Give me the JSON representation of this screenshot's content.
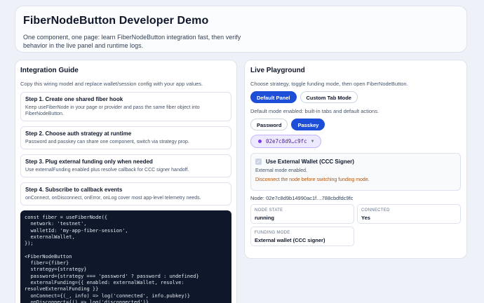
{
  "header": {
    "title": "FiberNodeButton Developer Demo",
    "description": "One component, one page: learn FiberNodeButton integration fast, then verify behavior in the live panel and runtime logs."
  },
  "guide": {
    "title": "Integration Guide",
    "subtitle": "Copy this wiring model and replace wallet/session config with your app values.",
    "steps": [
      {
        "title": "Step 1. Create one shared fiber hook",
        "desc": "Keep useFiberNode in your page or provider and pass the same fiber object into FiberNodeButton."
      },
      {
        "title": "Step 2. Choose auth strategy at runtime",
        "desc": "Password and passkey can share one component, switch via strategy prop."
      },
      {
        "title": "Step 3. Plug external funding only when needed",
        "desc": "Use externalFunding enabled plus resolve callback for CCC signer handoff."
      },
      {
        "title": "Step 4. Subscribe to callback events",
        "desc": "onConnect, onDisconnect, onError, onLog cover most app-level telemetry needs."
      }
    ],
    "code": "const fiber = useFiberNode({\n  network: 'testnet',\n  walletId: 'my-app-fiber-session',\n  externalWallet,\n});\n\n<FiberNodeButton\n  fiber={fiber}\n  strategy={strategy}\n  password={strategy === 'password' ? password : undefined}\n  externalFunding={{ enabled: externalWallet, resolve:\nresolveExternalFunding }}\n  onConnect={(_, info) => log('connected', info.pubkey)}\n  onDisconnect={() => log('disconnected')}"
  },
  "playground": {
    "title": "Live Playground",
    "subtitle": "Choose strategy, toggle funding mode, then open FiberNodeButton.",
    "mode_buttons": {
      "default": "Default Panel",
      "custom": "Custom Tab Mode"
    },
    "mode_hint": "Default mode enabled: built-in tabs and default actions.",
    "auth_buttons": {
      "password": "Password",
      "passkey": "Passkey"
    },
    "node_button": {
      "label": "02e7c8d9…c9fc"
    },
    "external": {
      "checkbox_label": "Use External Wallet (CCC Signer)",
      "status": "External mode enabled.",
      "warning": "Disconnect the node before switching funding mode."
    },
    "node_line": "Node: 02e7c8d9b14990ac1f…788cbdfdc9fc",
    "stats": [
      {
        "key": "NODE STATE",
        "value": "running"
      },
      {
        "key": "CONNECTED",
        "value": "Yes"
      },
      {
        "key": "FUNDING MODE",
        "value": "External wallet (CCC signer)"
      }
    ]
  },
  "colors": {
    "accent": "#1d4ed8",
    "warning": "#b45309",
    "code_bg": "#0f172a"
  },
  "icons": {
    "checkbox": "check-icon",
    "node_status": "status-dot-icon",
    "dropdown": "chevron-down-icon"
  }
}
